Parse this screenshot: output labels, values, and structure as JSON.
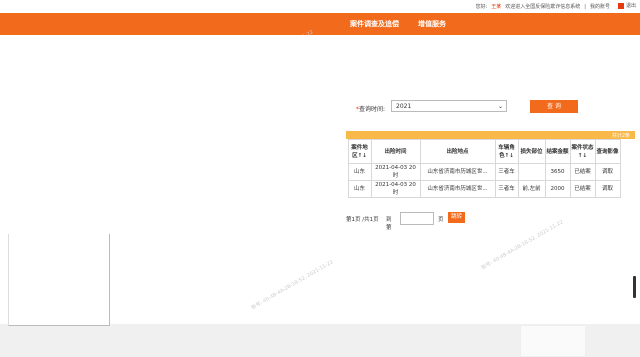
{
  "topbar": {
    "greeting": "您好:",
    "username": "王某",
    "welcome": "欢迎进入全国反保险欺诈信息系统",
    "my_account": "我的账号",
    "logout": "退出"
  },
  "nav": {
    "items": [
      "案件调查及追偿",
      "增值服务"
    ]
  },
  "query": {
    "label": "查询时间:",
    "required_mark": "*",
    "selected_year": "2021",
    "button": "查 询"
  },
  "results": {
    "total": "共计2条",
    "headers": [
      "案件地区↑↓",
      "出险时间",
      "出险地点",
      "车辆角色↑↓",
      "损失部位",
      "结案金额",
      "案件状态↑↓",
      "查询影像"
    ],
    "rows": [
      [
        "山东",
        "2021-04-03 20时",
        "山东省济南市历城区世...",
        "三者车",
        "",
        "3650",
        "已结案",
        "调取"
      ],
      [
        "山东",
        "2021-04-03 20时",
        "山东省济南市历城区世...",
        "三者车",
        "前,左前",
        "2000",
        "已结案",
        "调取"
      ]
    ],
    "left_cut": [
      "山",
      "山"
    ]
  },
  "pager": {
    "info": "第1页 /共1页",
    "goto_label": "到第",
    "page_unit": "页",
    "go_button": "跳转"
  },
  "watermark": "账号: 40-4B-4A-2B-18-52, 2021-11-22"
}
